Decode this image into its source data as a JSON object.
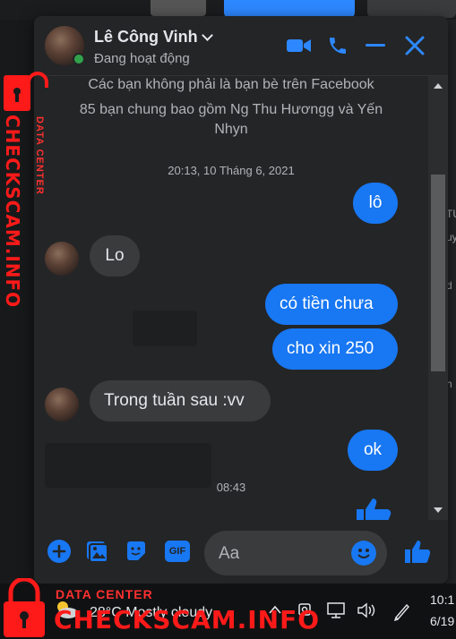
{
  "header": {
    "name": "Lê Công Vinh",
    "status": "Đang hoạt động"
  },
  "messages": {
    "info_line1": "Các bạn không phải là bạn bè trên Facebook",
    "info_line2": "85 bạn chung bao gồm Ng Thu Hươngg và Yến",
    "info_line3": "Nhyn",
    "timestamp1": "20:13, 10 Tháng 6, 2021",
    "m1": "lô",
    "m2": "Lo",
    "m3": "có tiền chưa",
    "m4": "cho xin 250",
    "m5": "Trong tuần sau :vv",
    "m6": "ok",
    "timestamp2": "08:43"
  },
  "composer": {
    "placeholder": "Aa",
    "gif_label": "GIF"
  },
  "taskbar": {
    "weather": "28°C  Mostly cloudy",
    "time": "10:1",
    "date": "6/19"
  },
  "watermark": {
    "brand": "CHECKSCAM.INFO",
    "tagline": "DATA CENTER"
  },
  "background_right": [
    "TU",
    "uy",
    "h",
    "d"
  ],
  "colors": {
    "accent": "#1877f2",
    "online": "#31a24c",
    "panel": "#242526",
    "watermark": "#ff1a1a"
  }
}
